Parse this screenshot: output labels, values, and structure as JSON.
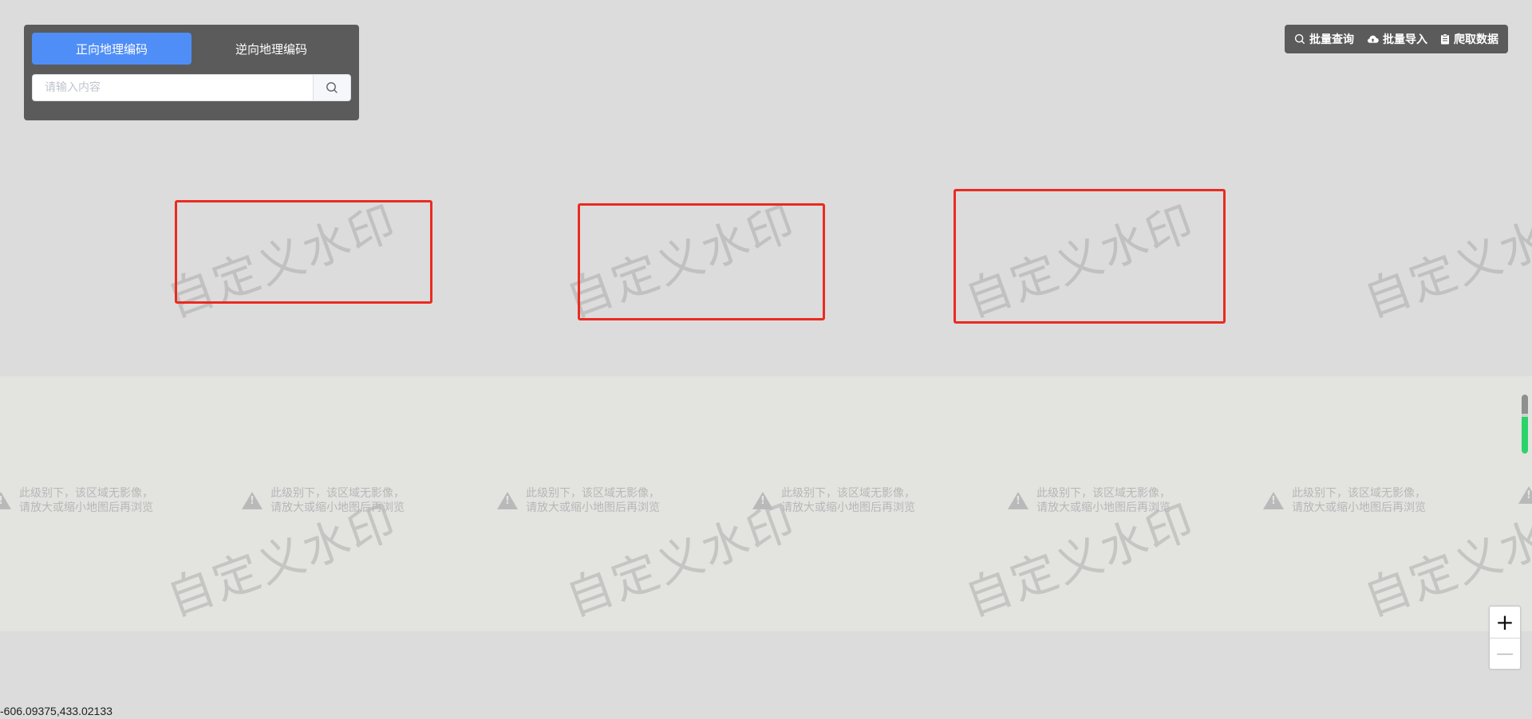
{
  "tabs": [
    {
      "label": "正向地理编码",
      "active": true
    },
    {
      "label": "逆向地理编码",
      "active": false
    }
  ],
  "search": {
    "placeholder": "请输入内容",
    "value": ""
  },
  "toolbar": {
    "batch_query_label": "批量查询",
    "batch_import_label": "批量导入",
    "crawl_data_label": "爬取数据"
  },
  "watermark": {
    "text": "自定义水印"
  },
  "tile_message": {
    "line1": "此级别下，该区域无影像，",
    "line2": "请放大或缩小地图后再浏览"
  },
  "zoom": {
    "in_label": "+",
    "out_label": "—",
    "level_fraction": 0.62
  },
  "coordinate_readout": "-606.09375,433.02133",
  "colors": {
    "map_background": "#dcdcdc",
    "tile_background": "#e3e3e0",
    "panel_background": "#5b5b5b",
    "active_tab": "#4f8ef7",
    "rectangle_stroke": "#ea2b21",
    "level_fill": "#2ad46a"
  },
  "icons": {
    "search": "search-icon",
    "batch_query": "search-icon",
    "batch_import": "cloud-upload-icon",
    "crawl_data": "clipboard-icon",
    "warning": "warning-icon"
  }
}
